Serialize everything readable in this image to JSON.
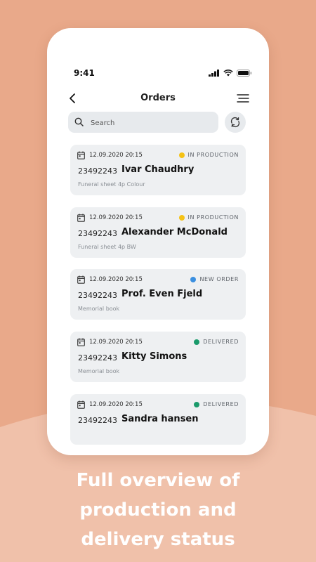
{
  "status_bar": {
    "time": "9:41"
  },
  "header": {
    "title": "Orders"
  },
  "search": {
    "placeholder": "Search"
  },
  "orders": [
    {
      "date": "12.09.2020 20:15",
      "status": "IN PRODUCTION",
      "status_color": "#f5c215",
      "number": "23492243",
      "customer": "Ivar Chaudhry",
      "product": "Funeral sheet 4p Colour"
    },
    {
      "date": "12.09.2020 20:15",
      "status": "IN PRODUCTION",
      "status_color": "#f5c215",
      "number": "23492243",
      "customer": "Alexander McDonald",
      "product": "Funeral sheet 4p BW"
    },
    {
      "date": "12.09.2020 20:15",
      "status": "NEW ORDER",
      "status_color": "#3b8fe0",
      "number": "23492243",
      "customer": "Prof. Even Fjeld",
      "product": "Memorial book"
    },
    {
      "date": "12.09.2020 20:15",
      "status": "DELIVERED",
      "status_color": "#1a9a6b",
      "number": "23492243",
      "customer": "Kitty Simons",
      "product": "Memorial book"
    },
    {
      "date": "12.09.2020 20:15",
      "status": "DELIVERED",
      "status_color": "#1a9a6b",
      "number": "23492243",
      "customer": "Sandra hansen",
      "product": ""
    }
  ],
  "caption": {
    "line1": "Full overview of",
    "line2": "production and",
    "line3": "delivery status"
  },
  "colors": {
    "background": "#e9a98a",
    "wave": "#f0c1aa",
    "card": "#eef0f2"
  },
  "icons": {
    "back": "chevron-left-icon",
    "menu": "menu-icon",
    "search": "search-icon",
    "refresh": "refresh-icon",
    "calendar": "calendar-icon"
  }
}
